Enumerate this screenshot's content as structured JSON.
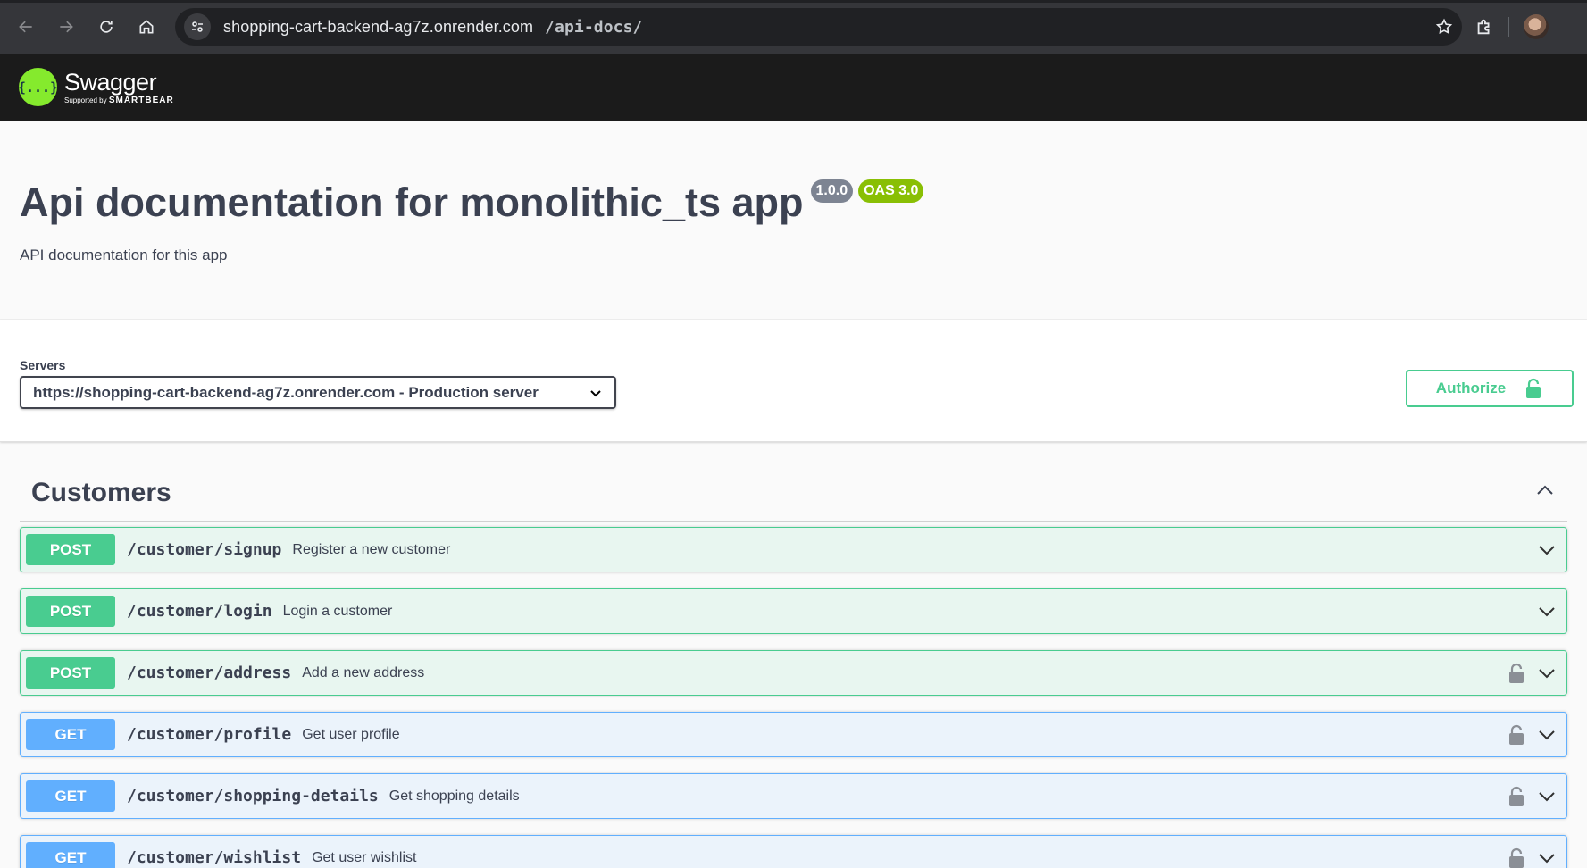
{
  "browser": {
    "url_host": "shopping-cart-backend-ag7z.onrender.com",
    "url_path": "/api-docs/"
  },
  "header": {
    "logo_glyph": "{...}",
    "logo_name": "Swagger",
    "logo_sub_prefix": "Supported by",
    "logo_sub_brand": "SMARTBEAR"
  },
  "info": {
    "title": "Api documentation for monolithic_ts app",
    "version": "1.0.0",
    "oas": "OAS 3.0",
    "description": "API documentation for this app"
  },
  "servers": {
    "label": "Servers",
    "selected": "https://shopping-cart-backend-ag7z.onrender.com - Production server"
  },
  "authorize": {
    "label": "Authorize"
  },
  "tag": {
    "name": "Customers",
    "operations": [
      {
        "method": "POST",
        "path": "/customer/signup",
        "summary": "Register a new customer",
        "locked": false
      },
      {
        "method": "POST",
        "path": "/customer/login",
        "summary": "Login a customer",
        "locked": false
      },
      {
        "method": "POST",
        "path": "/customer/address",
        "summary": "Add a new address",
        "locked": true
      },
      {
        "method": "GET",
        "path": "/customer/profile",
        "summary": "Get user profile",
        "locked": true
      },
      {
        "method": "GET",
        "path": "/customer/shopping-details",
        "summary": "Get shopping details",
        "locked": true
      },
      {
        "method": "GET",
        "path": "/customer/wishlist",
        "summary": "Get user wishlist",
        "locked": true
      }
    ]
  },
  "colors": {
    "post": "#49cc90",
    "get": "#61affe",
    "swagger_green": "#85ea2d",
    "topbar": "#1b1b1b"
  }
}
